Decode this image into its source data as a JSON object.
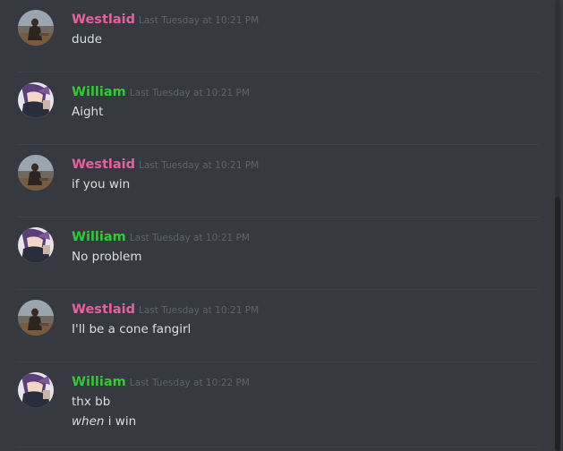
{
  "colors": {
    "background": "#36393f",
    "westlaid": "#e7609d",
    "william": "#2ecc2e",
    "timestamp": "#5f636b",
    "text": "#dcddde"
  },
  "messages": [
    {
      "author": "Westlaid",
      "author_key": "westlaid",
      "timestamp": "Last Tuesday at 10:21 PM",
      "text": "dude"
    },
    {
      "author": "William",
      "author_key": "william",
      "timestamp": "Last Tuesday at 10:21 PM",
      "text": "Aight"
    },
    {
      "author": "Westlaid",
      "author_key": "westlaid",
      "timestamp": "Last Tuesday at 10:21 PM",
      "text": "if you win"
    },
    {
      "author": "William",
      "author_key": "william",
      "timestamp": "Last Tuesday at 10:21 PM",
      "text": "No problem"
    },
    {
      "author": "Westlaid",
      "author_key": "westlaid",
      "timestamp": "Last Tuesday at 10:21 PM",
      "text": "I'll be a cone fangirl"
    },
    {
      "author": "William",
      "author_key": "william",
      "timestamp": "Last Tuesday at 10:22 PM",
      "text": "thx bb",
      "extra_emphasis": "when",
      "extra_rest": " i win"
    }
  ]
}
